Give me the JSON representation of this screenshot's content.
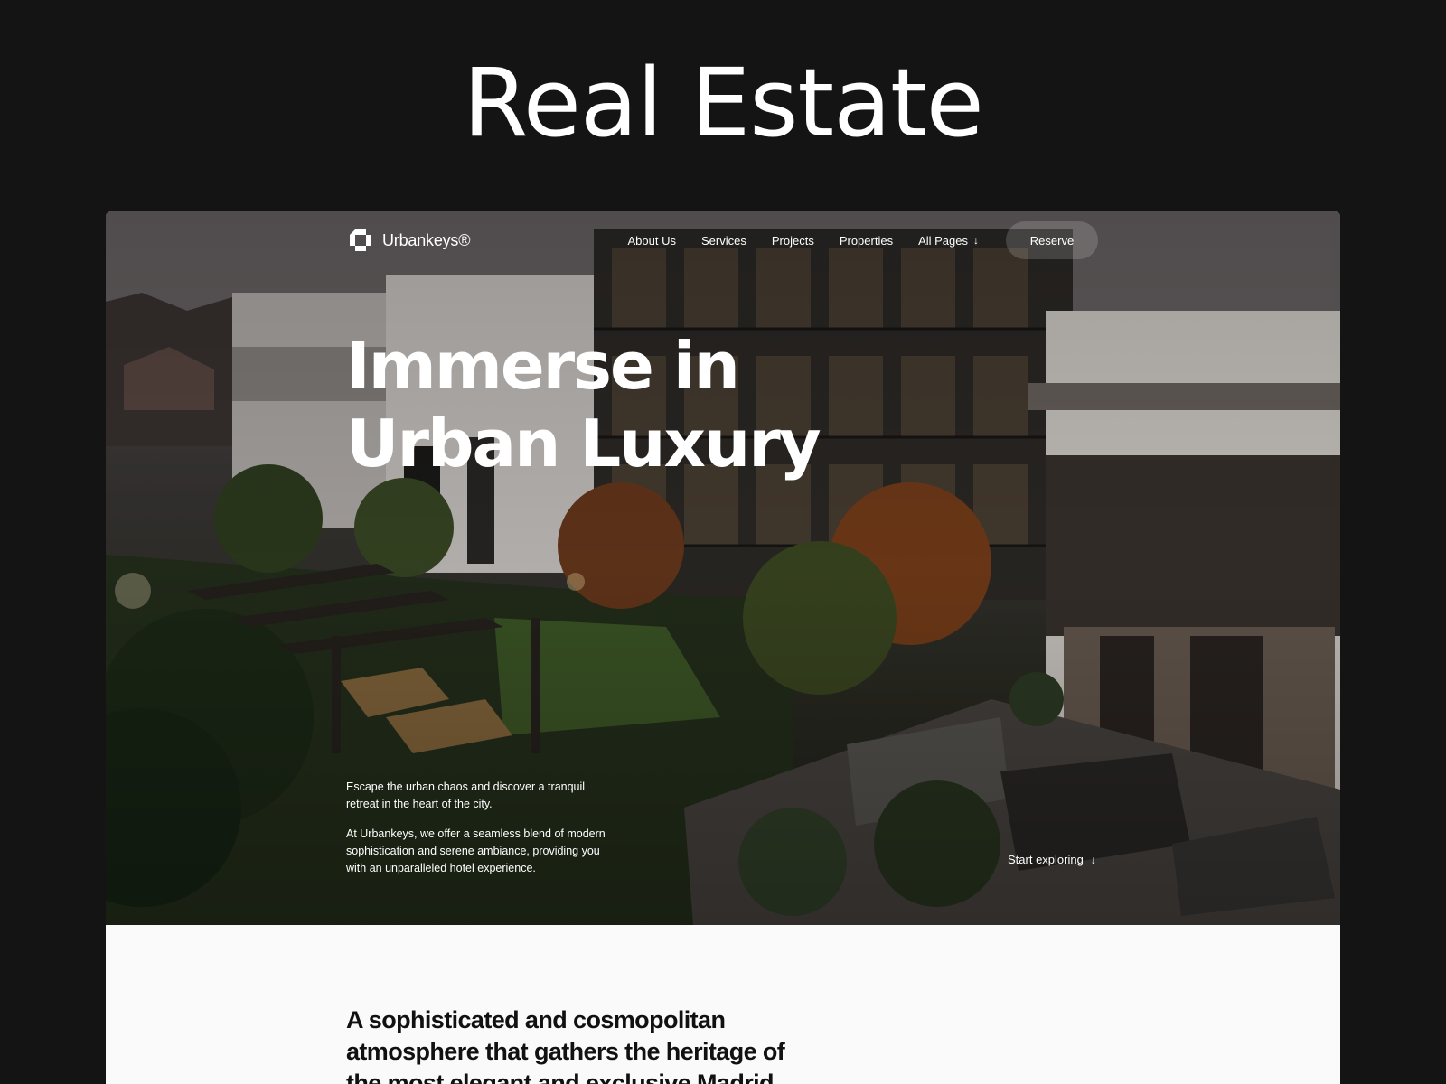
{
  "showcase": {
    "title": "Real Estate"
  },
  "nav": {
    "brand": "Urbankeys®",
    "links": [
      "About Us",
      "Services",
      "Projects",
      "Properties"
    ],
    "all_pages": "All Pages",
    "reserve": "Reserve"
  },
  "hero": {
    "title_line1": "Immerse in",
    "title_line2": "Urban Luxury",
    "intro1": "Escape the urban chaos and discover a tranquil retreat in the heart of the city.",
    "intro2": "At Urbankeys, we offer a seamless blend of modern sophistication and serene ambiance, providing you with an unparalleled hotel experience.",
    "start": "Start exploring"
  },
  "lower": {
    "statement": "A sophisticated and cosmopolitan atmosphere that gathers the heritage of the most elegant and exclusive Madrid"
  },
  "icons": {
    "logo": "urbankeys-logo-icon",
    "arrow": "arrow-down-icon"
  },
  "colors": {
    "page_bg": "#141414",
    "text_light": "#ffffff",
    "text_dark": "#111111",
    "lower_bg": "#fafafa"
  }
}
